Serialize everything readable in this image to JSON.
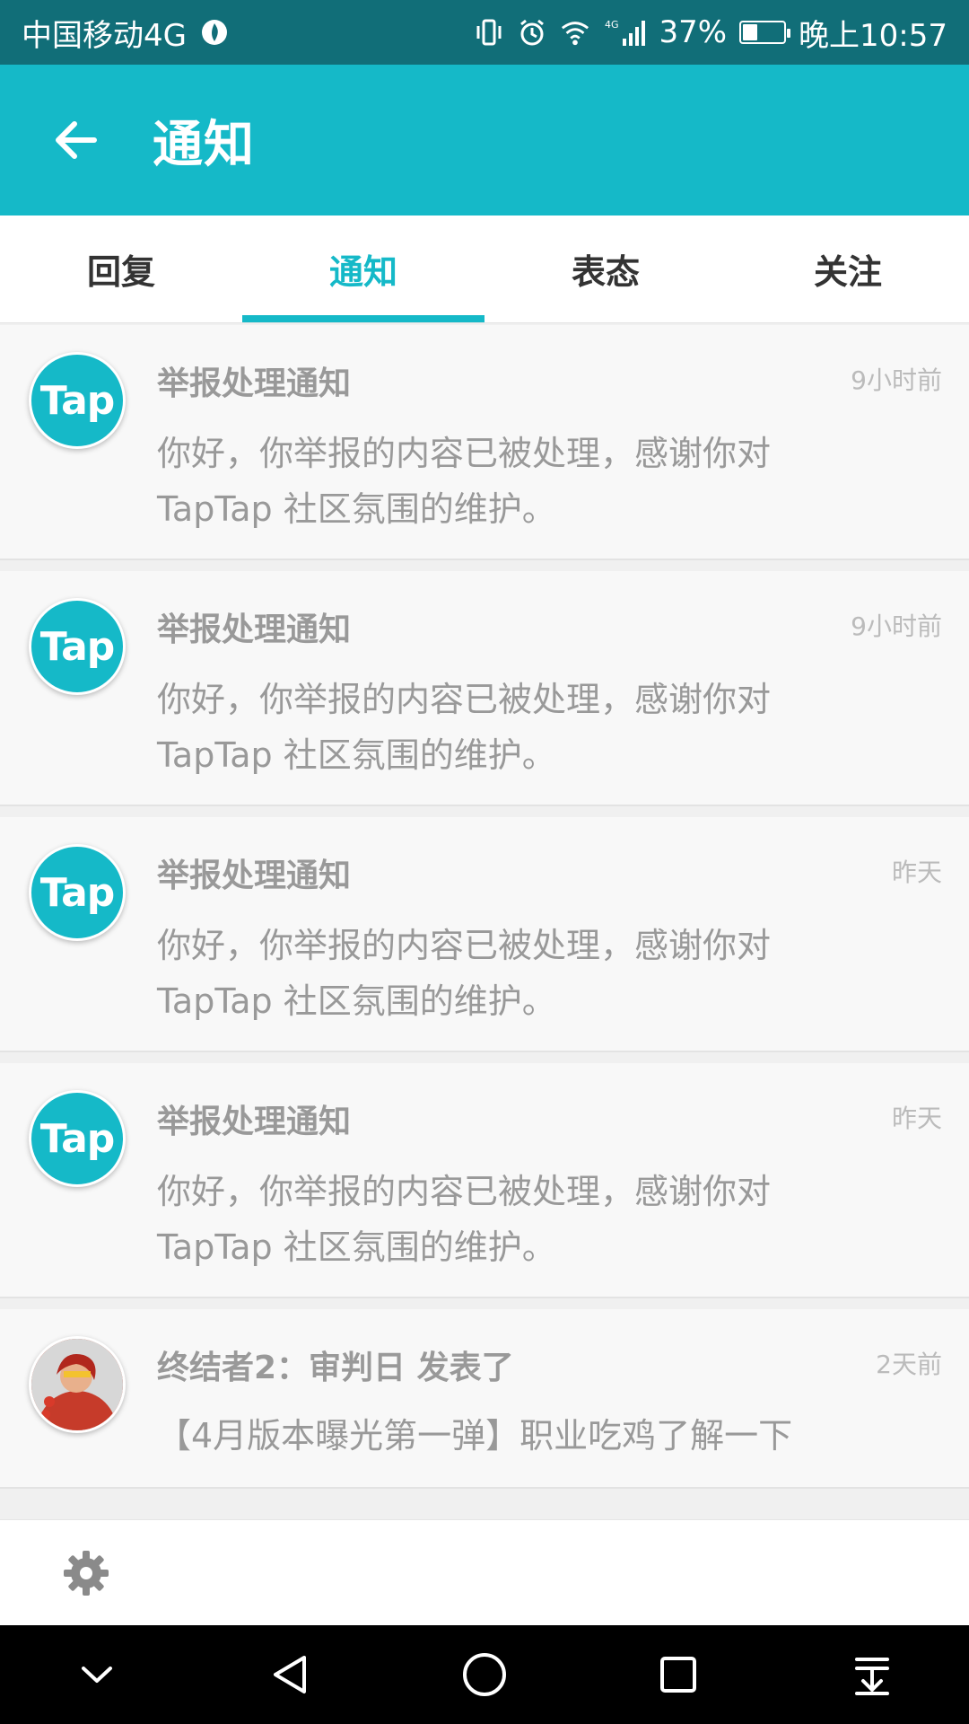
{
  "status_bar": {
    "carrier": "中国移动4G",
    "network": "4G",
    "battery": "37%",
    "battery_level": 0.37,
    "time": "晚上10:57"
  },
  "header": {
    "title": "通知"
  },
  "tabs": [
    {
      "label": "回复",
      "active": false
    },
    {
      "label": "通知",
      "active": true
    },
    {
      "label": "表态",
      "active": false
    },
    {
      "label": "关注",
      "active": false
    }
  ],
  "notifications": [
    {
      "avatar_text": "Tap",
      "title": "举报处理通知",
      "time": "9小时前",
      "body": "你好，你举报的内容已被处理，感谢你对TapTap 社区氛围的维护。"
    },
    {
      "avatar_text": "Tap",
      "title": "举报处理通知",
      "time": "9小时前",
      "body": "你好，你举报的内容已被处理，感谢你对TapTap 社区氛围的维护。"
    },
    {
      "avatar_text": "Tap",
      "title": "举报处理通知",
      "time": "昨天",
      "body": "你好，你举报的内容已被处理，感谢你对TapTap 社区氛围的维护。"
    },
    {
      "avatar_text": "Tap",
      "title": "举报处理通知",
      "time": "昨天",
      "body": "你好，你举报的内容已被处理，感谢你对TapTap 社区氛围的维护。"
    },
    {
      "avatar_text": "",
      "title": "终结者2：审判日 发表了",
      "time": "2天前",
      "body": "【4月版本曝光第一弹】职业吃鸡了解一下"
    }
  ],
  "colors": {
    "status_bar": "#116e78",
    "accent": "#15b9c8",
    "muted_text": "#999999",
    "nav_bar": "#000000"
  },
  "icons": {
    "back": "arrow-left-icon",
    "settings": "gear-icon",
    "nav": [
      "chevron-down-icon",
      "back-triangle-icon",
      "home-circle-icon",
      "recents-square-icon",
      "download-tray-icon"
    ]
  }
}
